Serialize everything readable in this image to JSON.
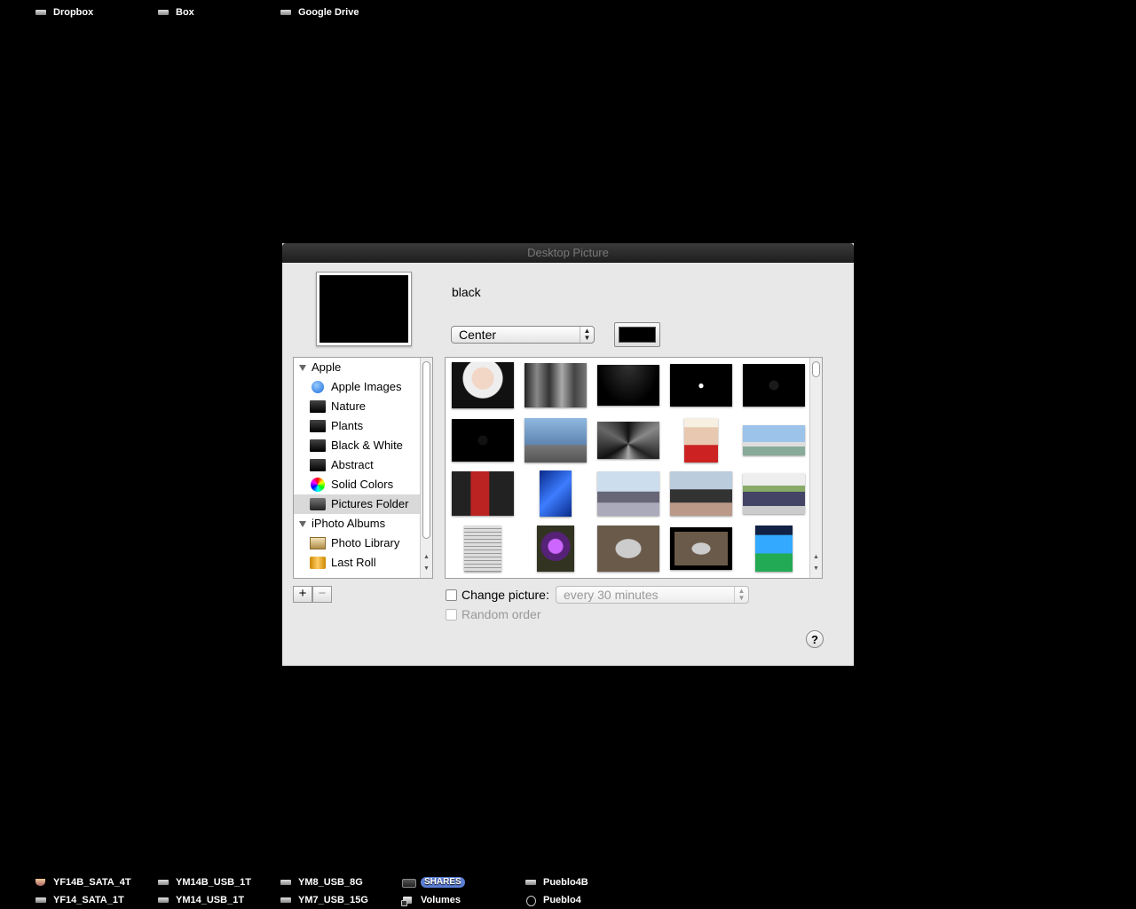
{
  "desktop": {
    "top_icons": [
      {
        "label": "Dropbox",
        "icon": "network-drive-icon"
      },
      {
        "label": "Box",
        "icon": "network-drive-icon"
      },
      {
        "label": "Google Drive",
        "icon": "network-drive-icon"
      }
    ],
    "bottom_icons": [
      {
        "label": "YF14B_SATA_4T",
        "icon": "coffee-drive-icon"
      },
      {
        "label": "YM14B_USB_1T",
        "icon": "external-drive-icon"
      },
      {
        "label": "YM8_USB_8G",
        "icon": "usb-drive-icon"
      },
      {
        "label": "SHARES",
        "icon": "shares-drive-icon"
      },
      {
        "label": "Pueblo4B",
        "icon": "server-drive-icon"
      },
      {
        "label": "YF14_SATA_1T",
        "icon": "drive-icon"
      },
      {
        "label": "YM14_USB_1T",
        "icon": "external-drive-icon"
      },
      {
        "label": "YM7_USB_15G",
        "icon": "usb-drive-icon"
      },
      {
        "label": "Volumes",
        "icon": "folder-alias-icon"
      },
      {
        "label": "Pueblo4",
        "icon": "apple-drive-icon"
      }
    ]
  },
  "window": {
    "title": "Desktop Picture",
    "picture_name": "black",
    "placement": "Center",
    "color_well": "#000000",
    "source_list": {
      "groups": [
        {
          "label": "Apple",
          "items": [
            {
              "label": "Apple Images",
              "icon": "apple-images-icon"
            },
            {
              "label": "Nature",
              "icon": "folder-black-icon"
            },
            {
              "label": "Plants",
              "icon": "folder-black-icon"
            },
            {
              "label": "Black & White",
              "icon": "folder-black-icon"
            },
            {
              "label": "Abstract",
              "icon": "folder-black-icon"
            },
            {
              "label": "Solid Colors",
              "icon": "color-wheel-icon"
            },
            {
              "label": "Pictures Folder",
              "icon": "pictures-folder-icon",
              "selected": true
            }
          ]
        },
        {
          "label": "iPhoto Albums",
          "items": [
            {
              "label": "Photo Library",
              "icon": "photo-library-icon"
            },
            {
              "label": "Last Roll",
              "icon": "film-roll-icon"
            }
          ]
        }
      ]
    },
    "add_button": "+",
    "remove_button": "−",
    "change_picture_label": "Change picture:",
    "change_interval": "every 30 minutes",
    "random_order_label": "Random order",
    "help_button": "?",
    "thumbnails": [
      [
        "portrait-photo",
        "street-bw-photo",
        "black-wallpaper",
        "apple-logo-black",
        "black-wallpaper-dark"
      ],
      [
        "black-apple-dark",
        "glass-building-photo",
        "bw-architecture-photo",
        "cosmopolitan-cover",
        "airship-photo"
      ],
      [
        "couple-red-photo",
        "blue-abstract",
        "jet-photo",
        "helicopter-photo",
        "group-photo"
      ],
      [
        "newspaper-photo",
        "purple-window-photo",
        "lighter-photo",
        "lighter-photo-framed",
        "phone-screenshot"
      ]
    ]
  }
}
